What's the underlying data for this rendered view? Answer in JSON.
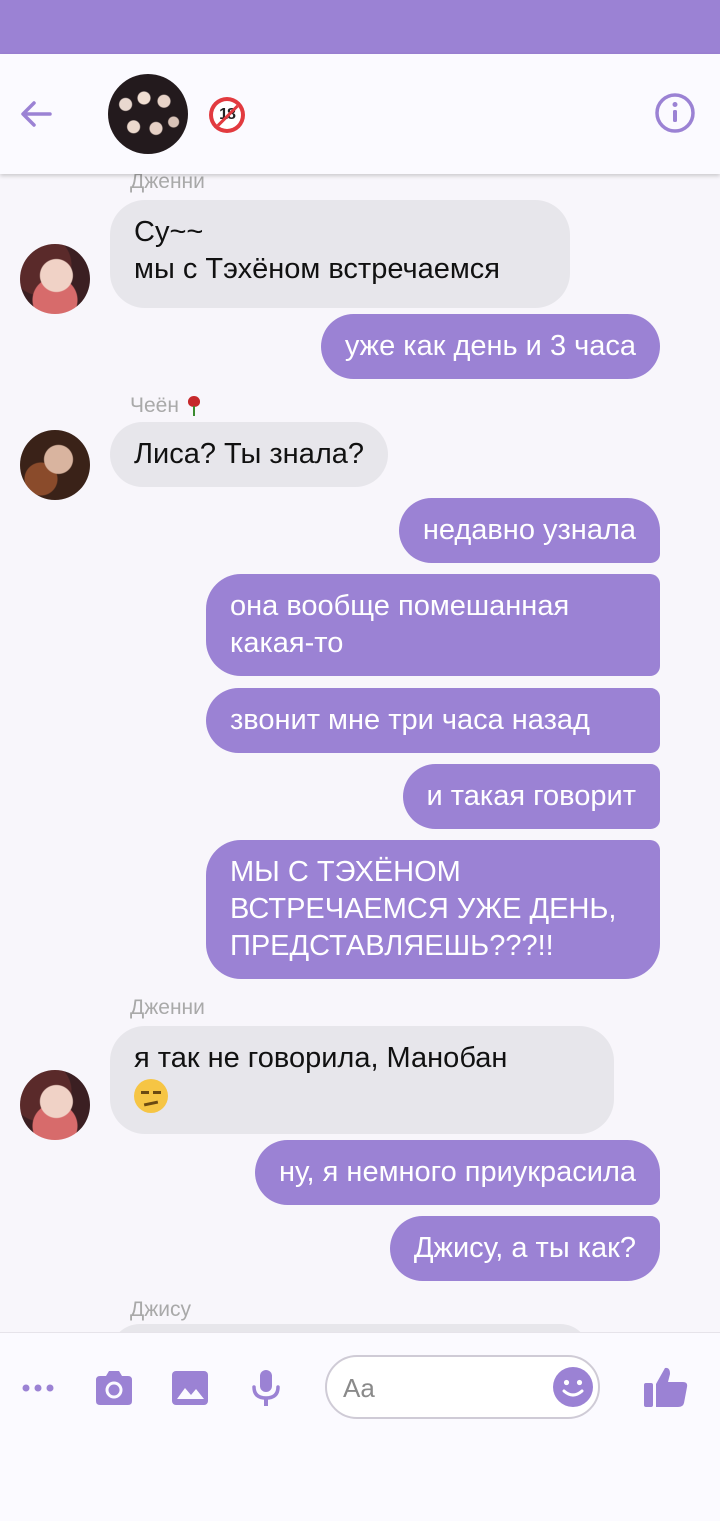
{
  "theme": {
    "accent": "#9b82d4",
    "incoming_bubble": "#e7e6eb"
  },
  "header": {
    "group_avatar": "group-photo",
    "badge": "18"
  },
  "messages": [
    {
      "type": "sender",
      "text": "Дженни"
    },
    {
      "type": "in",
      "text": "Су~~\nмы с Тэхёном встречаемся",
      "avatar": "jennie"
    },
    {
      "type": "out",
      "text": "уже как день и 3 часа"
    },
    {
      "type": "sender",
      "text": "Чеён",
      "icon": "rose"
    },
    {
      "type": "in",
      "text": "Лиса? Ты знала?",
      "avatar": "chaeyoung"
    },
    {
      "type": "out",
      "text": "недавно узнала"
    },
    {
      "type": "out",
      "text": "она вообще помешанная\nкакая-то"
    },
    {
      "type": "out",
      "text": "звонит мне три часа назад"
    },
    {
      "type": "out",
      "text": "и такая говорит"
    },
    {
      "type": "out",
      "text": "МЫ С ТЭХЁНОМ\nВСТРЕЧАЕМСЯ УЖЕ ДЕНЬ,\nПРЕДСТАВЛЯЕШЬ???!!"
    },
    {
      "type": "sender",
      "text": "Дженни"
    },
    {
      "type": "in",
      "text": "я так не говорила, Манобан",
      "emoji": "unamused",
      "avatar": "jennie"
    },
    {
      "type": "out",
      "text": "ну, я немного приукрасила"
    },
    {
      "type": "out",
      "text": "Джису, а ты как?"
    },
    {
      "type": "sender",
      "text": "Джису"
    }
  ],
  "composer": {
    "placeholder": "Aa"
  }
}
